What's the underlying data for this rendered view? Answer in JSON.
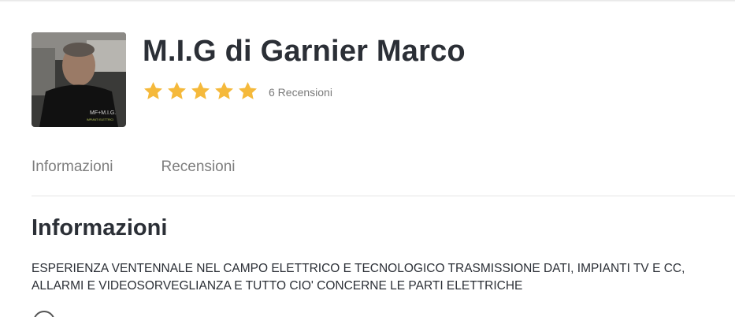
{
  "profile": {
    "name": "M.I.G di Garnier Marco",
    "rating": 5,
    "rating_max": 5,
    "reviews_label": "6 Recensioni",
    "avatar_shirt_text": "MF+M.I.G.",
    "avatar_shirt_subtext": "IMPIANTI ELETTRICI"
  },
  "tabs": [
    {
      "label": "Informazioni"
    },
    {
      "label": "Recensioni"
    }
  ],
  "info": {
    "title": "Informazioni",
    "description": "ESPERIENZA VENTENNALE NEL CAMPO ELETTRICO E TECNOLOGICO TRASMISSIONE DATI, IMPIANTI TV E CC, ALLARMI E VIDEOSORVEGLIANZA E TUTTO CIO' CONCERNE LE PARTI ELETTRICHE"
  },
  "colors": {
    "star": "#f5b93b",
    "title_text": "#2b2f36",
    "muted_text": "#7d7d7d",
    "divider": "#e4e4e4"
  },
  "icons": {
    "star": "star-icon",
    "more": "circle-icon"
  }
}
